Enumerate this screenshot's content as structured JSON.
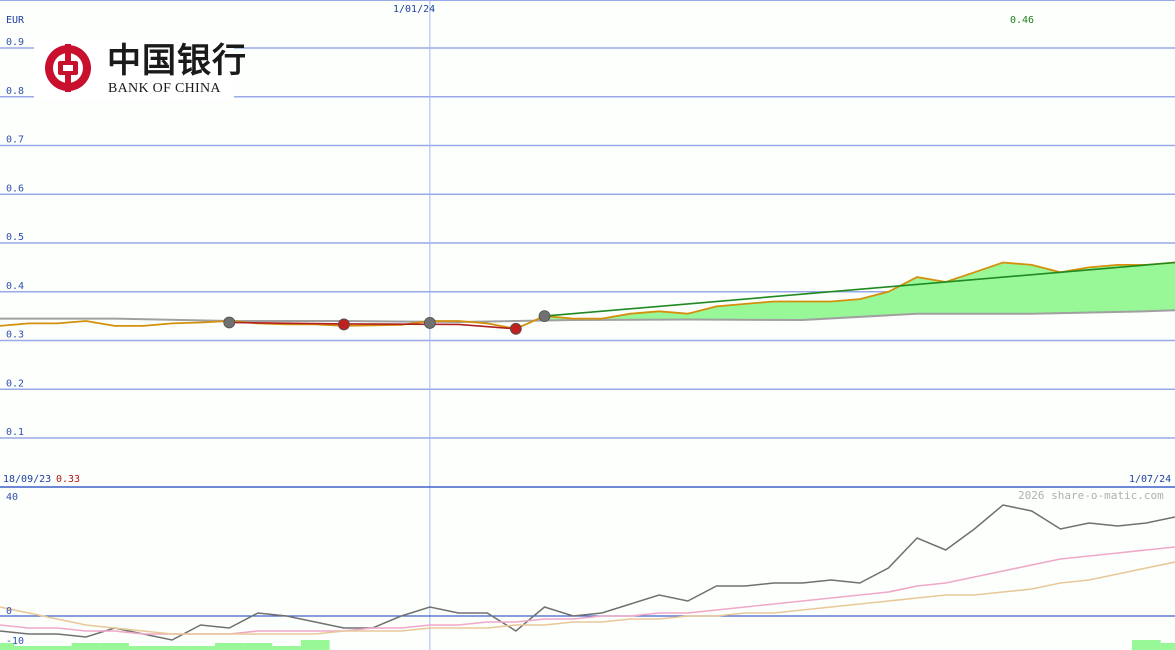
{
  "chart_data": [
    {
      "type": "line",
      "currency_label": "EUR",
      "y_ticks": [
        "0.9",
        "0.8",
        "0.7",
        "0.6",
        "0.5",
        "0.4",
        "0.3",
        "0.2",
        "0.1"
      ],
      "ylim": [
        0,
        1.0
      ],
      "x_range": [
        "2023-09-18",
        "2024-07-01"
      ],
      "date_marker": "1/01/24",
      "start_date_label": "18/09/23",
      "start_value_label": "0.33",
      "end_date_label": "1/07/24",
      "last_value_label": "0.46",
      "grid": true,
      "watermark": "2026 share-o-matic.com",
      "series": [
        {
          "color": "#d4900a",
          "x": [
            "2023-09-18",
            "2023-09-25",
            "2023-10-02",
            "2023-10-09",
            "2023-10-16",
            "2023-10-23",
            "2023-10-30",
            "2023-11-06",
            "2023-11-13",
            "2023-11-20",
            "2023-11-27",
            "2023-12-04",
            "2023-12-11",
            "2023-12-18",
            "2023-12-25",
            "2024-01-01",
            "2024-01-08",
            "2024-01-15",
            "2024-01-22",
            "2024-01-29",
            "2024-02-05",
            "2024-02-12",
            "2024-02-19",
            "2024-02-26",
            "2024-03-04",
            "2024-03-11",
            "2024-03-18",
            "2024-03-25",
            "2024-04-01",
            "2024-04-08",
            "2024-04-15",
            "2024-04-22",
            "2024-04-29",
            "2024-05-06",
            "2024-05-13",
            "2024-05-20",
            "2024-05-27",
            "2024-06-03",
            "2024-06-10",
            "2024-06-17",
            "2024-06-24",
            "2024-07-01"
          ],
          "values": [
            0.33,
            0.335,
            0.335,
            0.34,
            0.33,
            0.33,
            0.335,
            0.337,
            0.34,
            0.335,
            0.333,
            0.333,
            0.33,
            0.331,
            0.332,
            0.34,
            0.34,
            0.335,
            0.324,
            0.35,
            0.345,
            0.345,
            0.355,
            0.36,
            0.355,
            0.37,
            0.375,
            0.38,
            0.38,
            0.38,
            0.385,
            0.4,
            0.43,
            0.42,
            0.44,
            0.46,
            0.455,
            0.44,
            0.45,
            0.455,
            0.455,
            0.46
          ]
        },
        {
          "color": "#a0a0a0",
          "x": [
            "2023-09-18",
            "2023-10-16",
            "2023-11-13",
            "2023-12-11",
            "2024-01-08",
            "2024-02-05",
            "2024-03-04",
            "2024-04-01",
            "2024-04-29",
            "2024-05-27",
            "2024-06-24",
            "2024-07-01"
          ],
          "values": [
            0.345,
            0.345,
            0.34,
            0.34,
            0.338,
            0.342,
            0.343,
            0.342,
            0.355,
            0.355,
            0.36,
            0.362
          ]
        }
      ],
      "trend_segments": [
        {
          "color": "#b02020",
          "x": [
            "2023-11-13",
            "2023-12-11",
            "2024-01-08",
            "2024-01-22"
          ],
          "values": [
            0.337,
            0.334,
            0.333,
            0.324
          ]
        },
        {
          "color": "#208a20",
          "x": [
            "2024-01-29",
            "2024-07-01"
          ],
          "values": [
            0.35,
            0.46
          ]
        }
      ],
      "fill_region": {
        "color": "#98f898",
        "x_from": "2024-01-29"
      },
      "markers": [
        {
          "x": "2023-11-13",
          "value": 0.337,
          "color": "#707070"
        },
        {
          "x": "2023-12-11",
          "value": 0.333,
          "color": "#c02020"
        },
        {
          "x": "2024-01-01",
          "value": 0.336,
          "color": "#707070"
        },
        {
          "x": "2024-01-22",
          "value": 0.324,
          "color": "#c02020"
        },
        {
          "x": "2024-01-29",
          "value": 0.35,
          "color": "#707070"
        }
      ]
    },
    {
      "type": "line",
      "y_ticks": [
        "40",
        "0",
        "-10"
      ],
      "ylim": [
        -10,
        40
      ],
      "series": [
        {
          "color": "#707070",
          "values": [
            -5,
            -6,
            -6,
            -7,
            -4,
            -6,
            -8,
            -3,
            -4,
            1,
            0,
            -2,
            -4,
            -4,
            0,
            3,
            1,
            1,
            -5,
            3,
            0,
            1,
            4,
            7,
            5,
            10,
            10,
            11,
            11,
            12,
            11,
            16,
            26,
            22,
            29,
            37,
            35,
            29,
            31,
            30,
            31,
            33
          ]
        },
        {
          "color": "#f0a8c8",
          "values": [
            -3,
            -4,
            -4,
            -5,
            -5,
            -6,
            -6,
            -6,
            -6,
            -5,
            -5,
            -5,
            -5,
            -4,
            -4,
            -3,
            -3,
            -2,
            -2,
            -1,
            -1,
            0,
            0,
            1,
            1,
            2,
            3,
            4,
            5,
            6,
            7,
            8,
            10,
            11,
            13,
            15,
            17,
            19,
            20,
            21,
            22,
            23
          ]
        },
        {
          "color": "#e8c898",
          "values": [
            3,
            1,
            -1,
            -3,
            -4,
            -5,
            -6,
            -6,
            -6,
            -6,
            -6,
            -6,
            -5,
            -5,
            -5,
            -4,
            -4,
            -4,
            -3,
            -3,
            -2,
            -2,
            -1,
            -1,
            0,
            0,
            1,
            1,
            2,
            3,
            4,
            5,
            6,
            7,
            7,
            8,
            9,
            11,
            12,
            14,
            16,
            18
          ]
        }
      ],
      "histogram": {
        "color": "#98f898",
        "values": [
          -9,
          -10,
          -10,
          -9,
          -9,
          -10,
          -10,
          -10,
          -9,
          -9,
          -10,
          -8,
          -8,
          -8,
          -8,
          -8,
          -8,
          -8,
          -8,
          -8,
          -8,
          -8,
          -8,
          -8,
          -8,
          -8,
          -8,
          -8,
          -8,
          -8,
          -8,
          -8,
          -8,
          -8,
          -8,
          -8,
          -8,
          -8,
          -8,
          -8,
          -8,
          -9
        ]
      }
    }
  ],
  "logo": {
    "chinese": "中国银行",
    "english": "BANK OF CHINA",
    "color": "#c8102e"
  },
  "colors": {
    "grid": "#9aaae8",
    "axis_divider": "#4060c8",
    "date_marker": "#a8b8f0"
  }
}
